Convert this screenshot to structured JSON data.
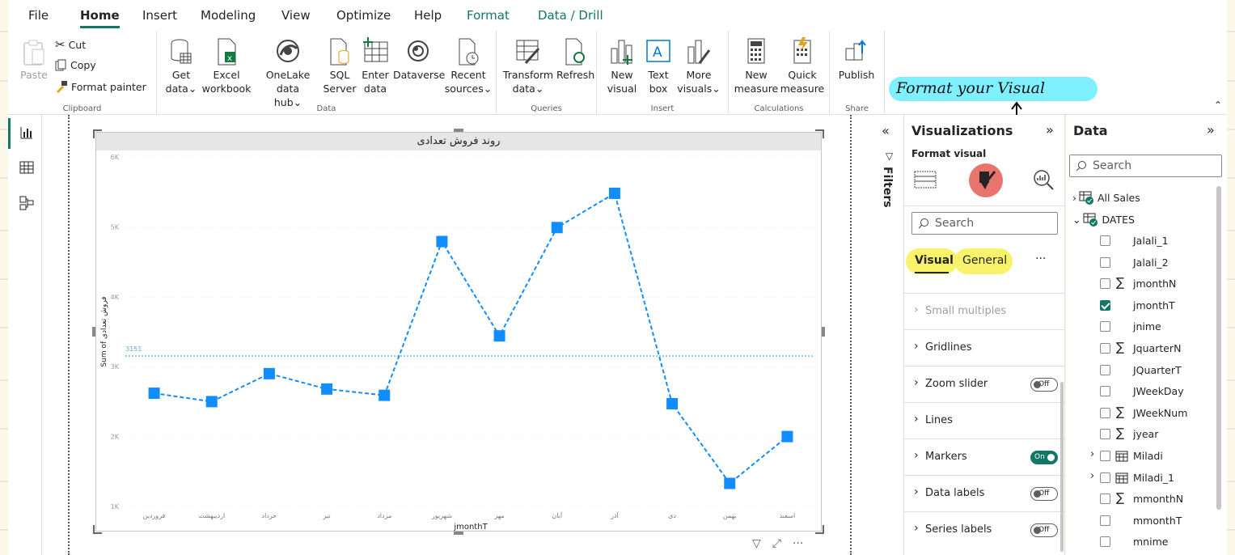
{
  "tabs": [
    "File",
    "Home",
    "Insert",
    "Modeling",
    "View",
    "Optimize",
    "Help",
    "Format",
    "Data / Drill"
  ],
  "ribbon": {
    "clipboard": {
      "paste": "Paste",
      "cut": "Cut",
      "copy": "Copy",
      "format_painter": "Format painter",
      "label": "Clipboard"
    },
    "data": {
      "get_data": [
        "Get",
        "data"
      ],
      "excel": [
        "Excel",
        "workbook"
      ],
      "onelake": [
        "OneLake data",
        "hub"
      ],
      "sql": [
        "SQL",
        "Server"
      ],
      "enter": [
        "Enter",
        "data"
      ],
      "dataverse": "Dataverse",
      "recent": [
        "Recent",
        "sources"
      ],
      "label": "Data"
    },
    "queries": {
      "transform": [
        "Transform",
        "data"
      ],
      "refresh": "Refresh",
      "label": "Queries"
    },
    "insert": {
      "new_visual": [
        "New",
        "visual"
      ],
      "text_box": [
        "Text",
        "box"
      ],
      "more_visuals": [
        "More",
        "visuals"
      ],
      "label": "Insert"
    },
    "calculations": {
      "new_measure": [
        "New",
        "measure"
      ],
      "quick_measure": [
        "Quick",
        "measure"
      ],
      "label": "Calculations"
    },
    "share": {
      "publish": "Publish",
      "label": "Share"
    }
  },
  "annotation": "Format your Visual",
  "visual": {
    "title": "روند فروش تعدادی"
  },
  "chart_data": {
    "type": "line",
    "ylabel": "Sum of فروش تعدادی",
    "xlabel": "jmonthT",
    "categories": [
      "فروردین",
      "اردیبهشت",
      "خرداد",
      "تیر",
      "مرداد",
      "شهریور",
      "مهر",
      "آبان",
      "آذر",
      "دی",
      "بهمن",
      "اسفند"
    ],
    "values": [
      2620,
      2500,
      2900,
      2680,
      2590,
      4790,
      3440,
      4990,
      5480,
      2470,
      1330,
      2000
    ],
    "yticks": [
      "6K",
      "5K",
      "4K",
      "3K",
      "2K",
      "1K"
    ],
    "ylim": [
      1000,
      6000
    ],
    "reference_line": {
      "value": 3151,
      "label": "3151"
    },
    "color": "#118dff",
    "style": "dashed line with square markers"
  },
  "filters": {
    "label": "Filters"
  },
  "visualizations": {
    "title": "Visualizations",
    "subtitle": "Format visual",
    "search_placeholder": "Search",
    "tab_visual": "Visual",
    "tab_general": "General",
    "more": "···",
    "sections": [
      {
        "label": "Small multiples",
        "toggle": ""
      },
      {
        "label": "Gridlines",
        "toggle": ""
      },
      {
        "label": "Zoom slider",
        "toggle": "Off"
      },
      {
        "label": "Lines",
        "toggle": ""
      },
      {
        "label": "Markers",
        "toggle": "On"
      },
      {
        "label": "Data labels",
        "toggle": "Off"
      },
      {
        "label": "Series labels",
        "toggle": "Off"
      }
    ]
  },
  "data_pane": {
    "title": "Data",
    "search_placeholder": "Search",
    "tables": [
      "All Sales",
      "DATES"
    ],
    "fields": [
      {
        "name": "Jalali_1",
        "sigma": false,
        "checked": false,
        "expand": false,
        "calendar": false
      },
      {
        "name": "Jalali_2",
        "sigma": false,
        "checked": false,
        "expand": false,
        "calendar": false
      },
      {
        "name": "jmonthN",
        "sigma": true,
        "checked": false,
        "expand": false,
        "calendar": false
      },
      {
        "name": "jmonthT",
        "sigma": false,
        "checked": true,
        "expand": false,
        "calendar": false
      },
      {
        "name": "jnime",
        "sigma": false,
        "checked": false,
        "expand": false,
        "calendar": false
      },
      {
        "name": "JquarterN",
        "sigma": true,
        "checked": false,
        "expand": false,
        "calendar": false
      },
      {
        "name": "JQuarterT",
        "sigma": false,
        "checked": false,
        "expand": false,
        "calendar": false
      },
      {
        "name": "JWeekDay",
        "sigma": false,
        "checked": false,
        "expand": false,
        "calendar": false
      },
      {
        "name": "JWeekNum",
        "sigma": true,
        "checked": false,
        "expand": false,
        "calendar": false
      },
      {
        "name": "jyear",
        "sigma": true,
        "checked": false,
        "expand": false,
        "calendar": false
      },
      {
        "name": "Miladi",
        "sigma": false,
        "checked": false,
        "expand": true,
        "calendar": true
      },
      {
        "name": "Miladi_1",
        "sigma": false,
        "checked": false,
        "expand": true,
        "calendar": true
      },
      {
        "name": "mmonthN",
        "sigma": true,
        "checked": false,
        "expand": false,
        "calendar": false
      },
      {
        "name": "mmonthT",
        "sigma": false,
        "checked": false,
        "expand": false,
        "calendar": false
      },
      {
        "name": "mnime",
        "sigma": false,
        "checked": false,
        "expand": false,
        "calendar": false
      }
    ]
  }
}
